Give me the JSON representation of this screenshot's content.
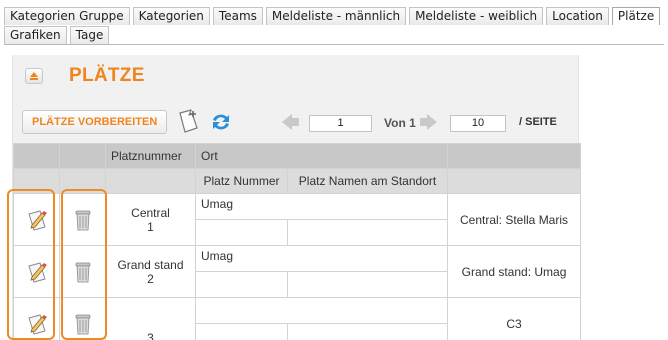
{
  "tabs": {
    "row1": [
      "Kategorien Gruppe",
      "Kategorien",
      "Teams",
      "Meldeliste - männlich",
      "Meldeliste - weiblich",
      "Location",
      "Plätze"
    ],
    "row2": [
      "Grafiken",
      "Tage"
    ],
    "active": "Plätze"
  },
  "panel": {
    "title": "PLÄTZE",
    "prepare_label": "PLÄTZE VORBEREITEN"
  },
  "pager": {
    "page": "1",
    "of_label": "Von 1",
    "page_size": "10",
    "per_label": "/ SEITE"
  },
  "table": {
    "headers": {
      "platznummer": "Platznummer",
      "ort": "Ort",
      "platz_nummer": "Platz Nummer",
      "platz_namen": "Platz Namen am Standort"
    },
    "rows": [
      {
        "name": "Central",
        "number": "1",
        "ort": "Umag",
        "summary": "Central: Stella Maris"
      },
      {
        "name": "Grand stand",
        "number": "2",
        "ort": "Umag",
        "summary": "Grand stand: Umag"
      },
      {
        "name": "",
        "number": "3",
        "ort": "",
        "summary": "C3"
      }
    ]
  },
  "colors": {
    "accent": "#f0851d",
    "header_bg": "#c8c8c8",
    "subheader_bg": "#dcdcdc",
    "highlight": "#f08a24"
  },
  "icons": [
    "collapse-icon",
    "new-document-icon",
    "refresh-icon",
    "prev-page-icon",
    "next-page-icon",
    "edit-icon",
    "trash-icon"
  ]
}
